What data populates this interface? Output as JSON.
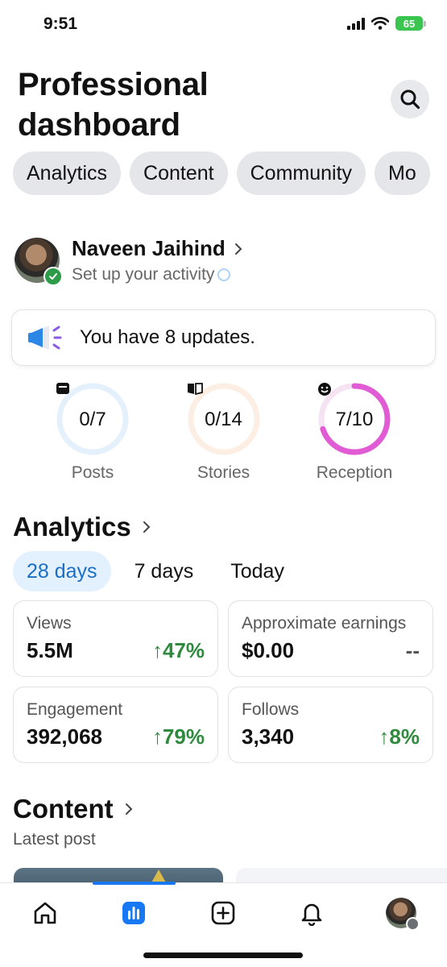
{
  "status_bar": {
    "time": "9:51",
    "battery": "65"
  },
  "header": {
    "title": "Professional dashboard",
    "search_icon": "search-icon"
  },
  "tabs": [
    {
      "label": "Analytics"
    },
    {
      "label": "Content"
    },
    {
      "label": "Community"
    },
    {
      "label": "Mo"
    }
  ],
  "profile": {
    "name": "Naveen Jaihind",
    "subtitle": "Set up your activity"
  },
  "updates": {
    "text": "You have 8 updates."
  },
  "stats": [
    {
      "value": "0/7",
      "label": "Posts",
      "icon": "posts-icon",
      "progress": 0,
      "track_color": "#e4f0fb",
      "color": "#3b8ee8"
    },
    {
      "value": "0/14",
      "label": "Stories",
      "icon": "stories-icon",
      "progress": 0,
      "track_color": "#fdeee4",
      "color": "#f08a4b"
    },
    {
      "value": "7/10",
      "label": "Reception",
      "icon": "smile-icon",
      "progress": 0.7,
      "track_color": "#f5e2f3",
      "color": "#e05bd4"
    }
  ],
  "analytics": {
    "title": "Analytics",
    "ranges": [
      {
        "label": "28 days",
        "active": true
      },
      {
        "label": "7 days",
        "active": false
      },
      {
        "label": "Today",
        "active": false
      }
    ],
    "cards": [
      {
        "label": "Views",
        "value": "5.5M",
        "delta": "47%",
        "trend": "up"
      },
      {
        "label": "Approximate earnings",
        "value": "$0.00",
        "delta": "--",
        "trend": "none"
      },
      {
        "label": "Engagement",
        "value": "392,068",
        "delta": "79%",
        "trend": "up"
      },
      {
        "label": "Follows",
        "value": "3,340",
        "delta": "8%",
        "trend": "up"
      }
    ]
  },
  "content": {
    "title": "Content",
    "subtitle": "Latest post"
  },
  "colors": {
    "accent": "#1877f2",
    "positive": "#2f8a3d",
    "chip_bg": "#e4e6ea"
  }
}
